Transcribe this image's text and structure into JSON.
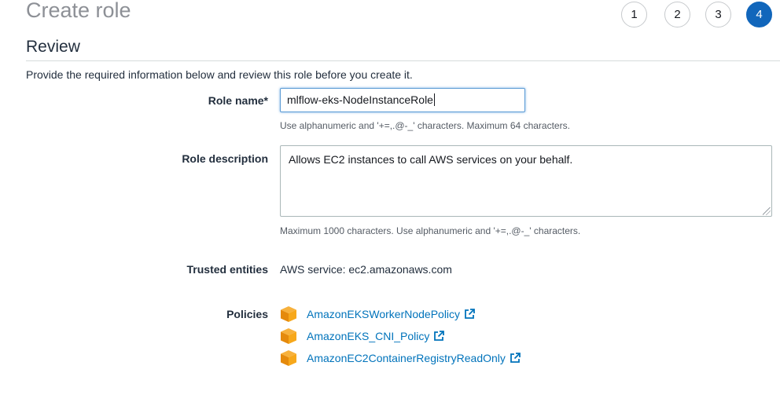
{
  "header": {
    "title": "Create role"
  },
  "steps": [
    {
      "label": "1",
      "active": false
    },
    {
      "label": "2",
      "active": false
    },
    {
      "label": "3",
      "active": false
    },
    {
      "label": "4",
      "active": true
    }
  ],
  "review": {
    "section_title": "Review",
    "intro": "Provide the required information below and review this role before you create it."
  },
  "role_name": {
    "label": "Role name*",
    "value": "mlflow-eks-NodeInstanceRole",
    "hint": "Use alphanumeric and '+=,.@-_' characters. Maximum 64 characters."
  },
  "role_description": {
    "label": "Role description",
    "value": "Allows EC2 instances to call AWS services on your behalf.",
    "hint": "Maximum 1000 characters. Use alphanumeric and '+=,.@-_' characters."
  },
  "trusted_entities": {
    "label": "Trusted entities",
    "value": "AWS service: ec2.amazonaws.com"
  },
  "policies": {
    "label": "Policies",
    "items": [
      {
        "name": "AmazonEKSWorkerNodePolicy",
        "icon": "policy-cube-icon"
      },
      {
        "name": "AmazonEKS_CNI_Policy",
        "icon": "policy-cube-icon"
      },
      {
        "name": "AmazonEC2ContainerRegistryReadOnly",
        "icon": "policy-cube-icon"
      }
    ]
  },
  "colors": {
    "accent": "#1166bb",
    "link": "#0073bb",
    "cube": "#f7a81b"
  }
}
